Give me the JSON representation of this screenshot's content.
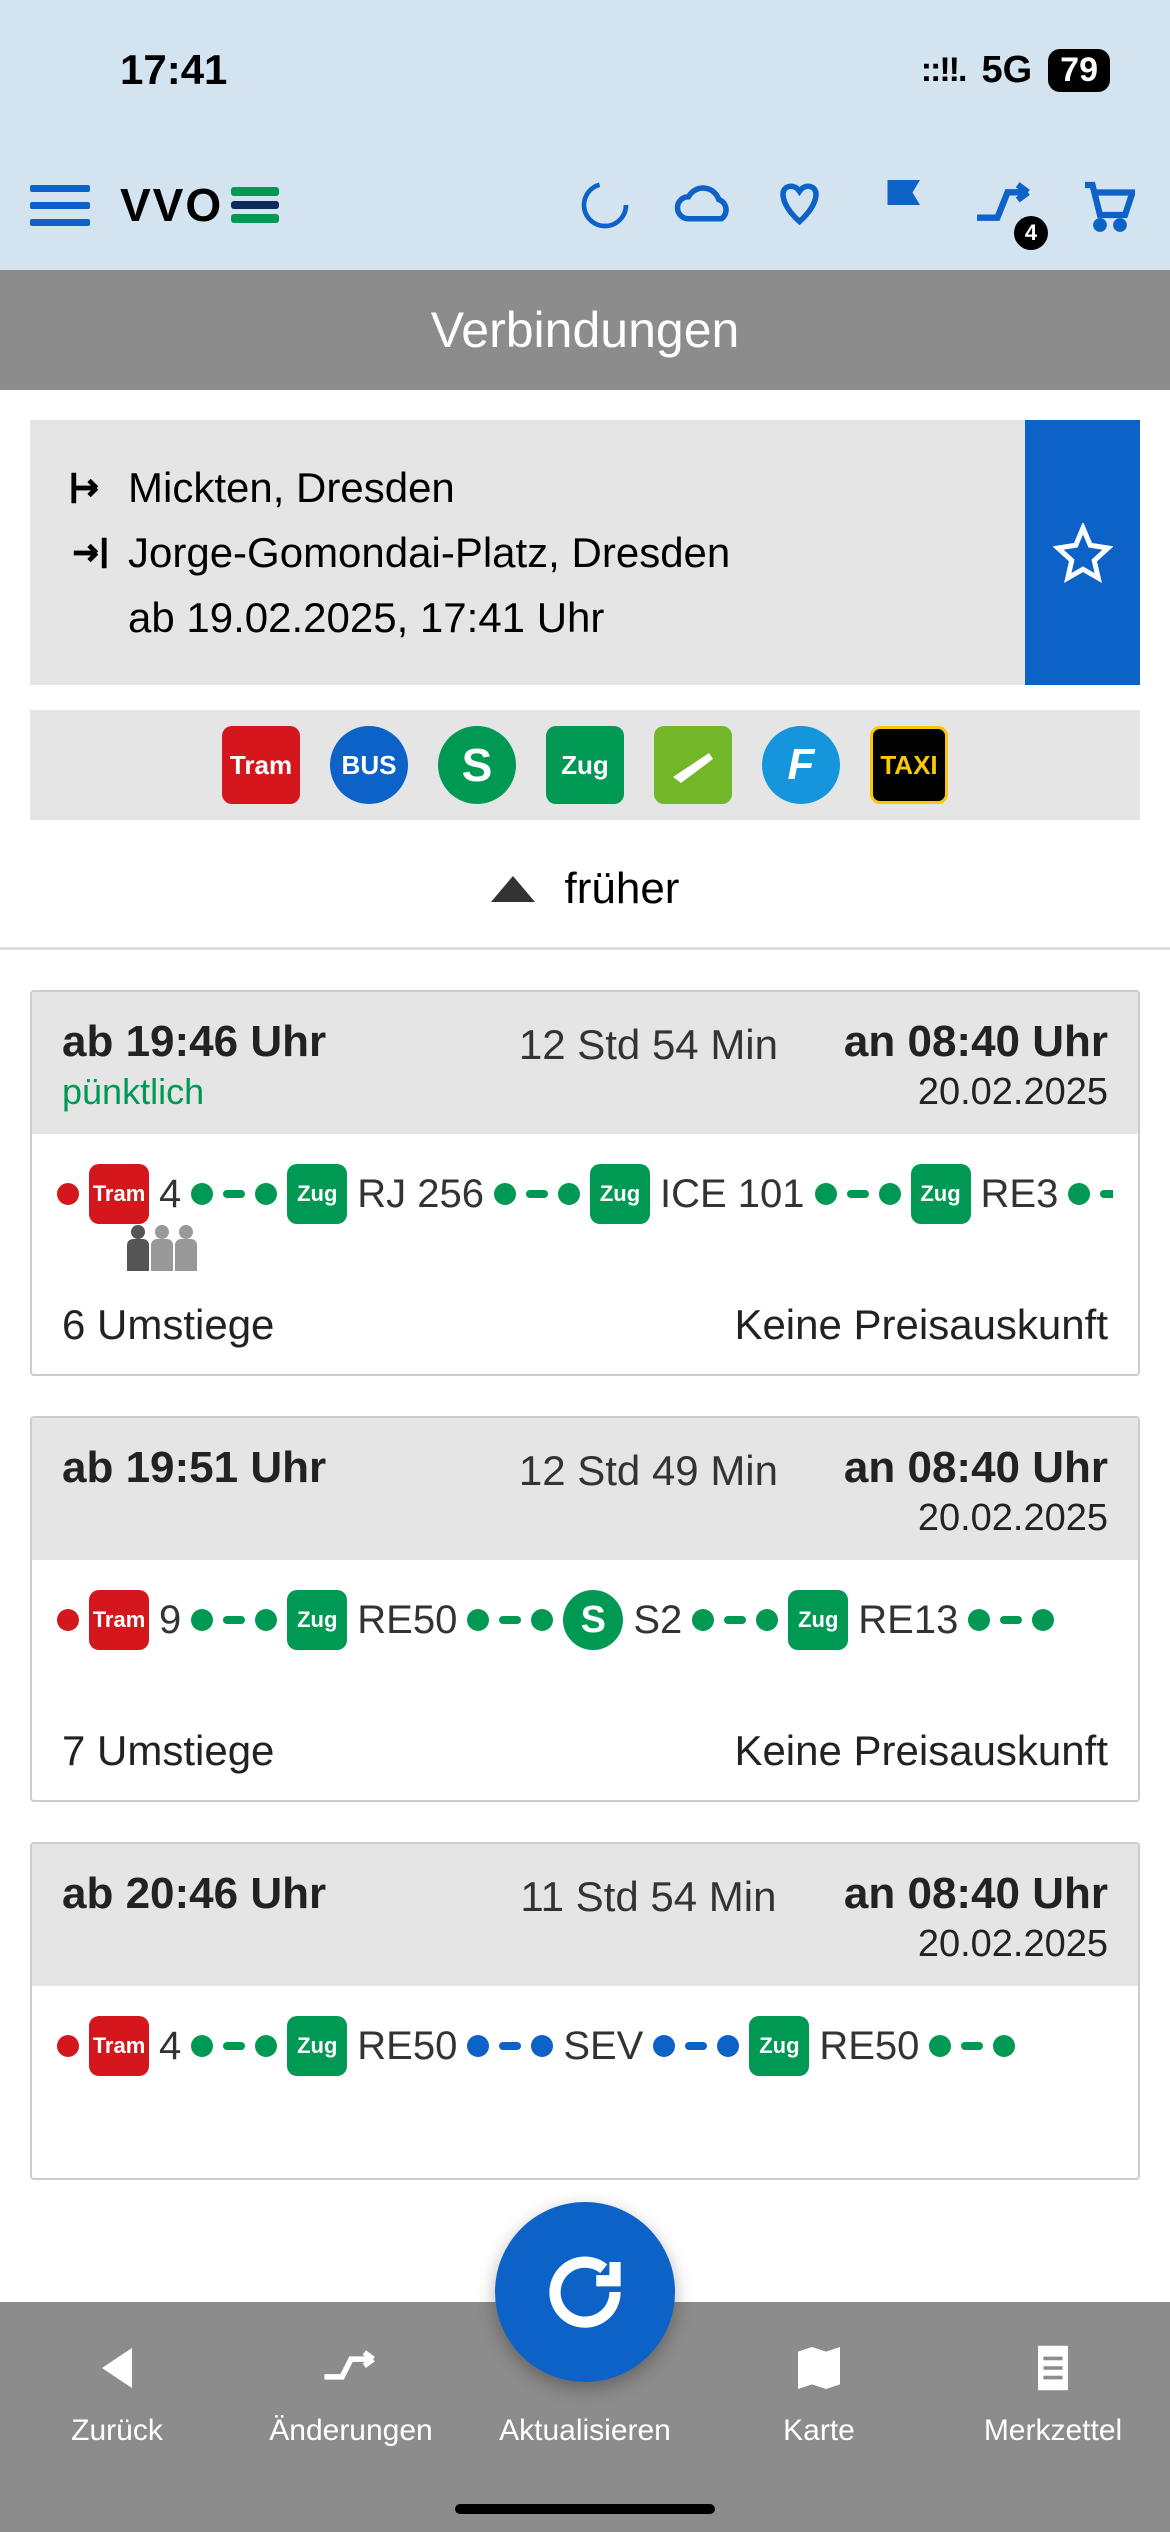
{
  "status": {
    "time": "17:41",
    "network": "5G",
    "battery": "79"
  },
  "toolbar": {
    "logo": "VVO",
    "badge": "4"
  },
  "pageTitle": "Verbindungen",
  "search": {
    "from": "Mickten, Dresden",
    "to": "Jorge-Gomondai-Platz, Dresden",
    "datetime": "ab 19.02.2025, 17:41 Uhr"
  },
  "modes": {
    "tram": "Tram",
    "bus": "BUS",
    "sbahn": "S",
    "zug": "Zug",
    "ferry": "F",
    "taxi": "TAXI"
  },
  "earlierLabel": "früher",
  "results": [
    {
      "depart": "ab 19:46 Uhr",
      "status": "pünktlich",
      "duration": "12 Std 54 Min",
      "arrive": "an 08:40 Uhr",
      "arriveDate": "20.02.2025",
      "legs": [
        {
          "type": "tram",
          "badge": "Tram",
          "label": "4"
        },
        {
          "type": "zug",
          "badge": "Zug",
          "label": "RJ 256"
        },
        {
          "type": "zug",
          "badge": "Zug",
          "label": "ICE 101"
        },
        {
          "type": "zug",
          "badge": "Zug",
          "label": "RE3"
        }
      ],
      "hasOccupancy": true,
      "transfers": "6 Umstiege",
      "price": "Keine Preisauskunft"
    },
    {
      "depart": "ab 19:51 Uhr",
      "status": "",
      "duration": "12 Std 49 Min",
      "arrive": "an 08:40 Uhr",
      "arriveDate": "20.02.2025",
      "legs": [
        {
          "type": "tram",
          "badge": "Tram",
          "label": "9"
        },
        {
          "type": "zug",
          "badge": "Zug",
          "label": "RE50"
        },
        {
          "type": "sbahn",
          "badge": "S",
          "label": "S2"
        },
        {
          "type": "zug",
          "badge": "Zug",
          "label": "RE13"
        }
      ],
      "hasOccupancy": false,
      "transfers": "7 Umstiege",
      "price": "Keine Preisauskunft"
    },
    {
      "depart": "ab 20:46 Uhr",
      "status": "",
      "duration": "11 Std 54 Min",
      "arrive": "an 08:40 Uhr",
      "arriveDate": "20.02.2025",
      "legs": [
        {
          "type": "tram",
          "badge": "Tram",
          "label": "4"
        },
        {
          "type": "zug",
          "badge": "Zug",
          "label": "RE50"
        },
        {
          "type": "sev",
          "badge": "",
          "label": "SEV"
        },
        {
          "type": "zug",
          "badge": "Zug",
          "label": "RE50"
        }
      ],
      "hasOccupancy": false,
      "transfers": "",
      "price": ""
    }
  ],
  "nav": {
    "back": "Zurück",
    "changes": "Änderungen",
    "refresh": "Aktualisieren",
    "map": "Karte",
    "notes": "Merkzettel"
  }
}
